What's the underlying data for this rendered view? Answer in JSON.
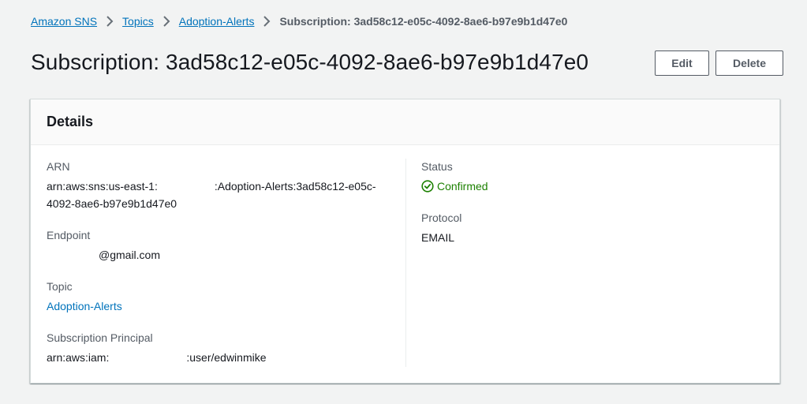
{
  "breadcrumb": {
    "items": [
      "Amazon SNS",
      "Topics",
      "Adoption-Alerts"
    ],
    "current": "Subscription: 3ad58c12-e05c-4092-8ae6-b97e9b1d47e0"
  },
  "page": {
    "title": "Subscription: 3ad58c12-e05c-4092-8ae6-b97e9b1d47e0"
  },
  "actions": {
    "edit_label": "Edit",
    "delete_label": "Delete"
  },
  "details": {
    "title": "Details",
    "arn": {
      "label": "ARN",
      "value_prefix": "arn:aws:sns:us-east-1:",
      "value_suffix": ":Adoption-Alerts:3ad58c12-e05c-4092-8ae6-b97e9b1d47e0"
    },
    "endpoint": {
      "label": "Endpoint",
      "value_suffix": "@gmail.com"
    },
    "topic": {
      "label": "Topic",
      "value": "Adoption-Alerts"
    },
    "principal": {
      "label": "Subscription Principal",
      "value_prefix": "arn:aws:iam:",
      "value_suffix": ":user/edwinmike"
    },
    "status": {
      "label": "Status",
      "value": "Confirmed",
      "color": "#1d8102",
      "icon": "check-circle-icon"
    },
    "protocol": {
      "label": "Protocol",
      "value": "EMAIL"
    }
  },
  "colors": {
    "link": "#0073bb",
    "background": "#f2f3f3",
    "success": "#1d8102"
  }
}
